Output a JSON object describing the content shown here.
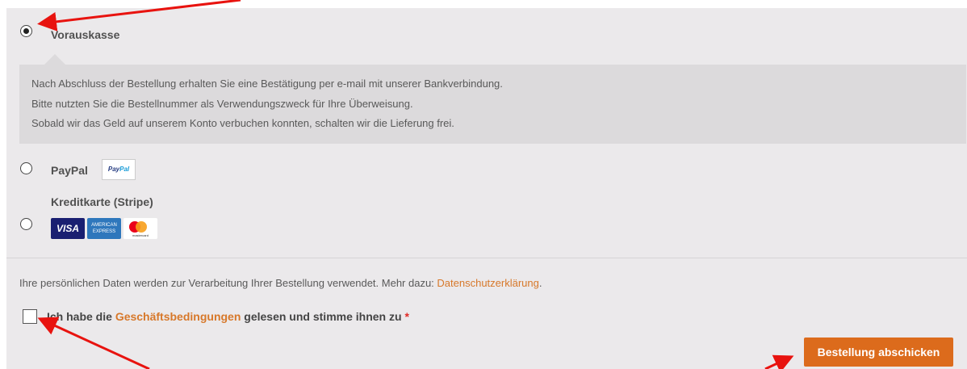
{
  "payment_methods": [
    {
      "label": "Vorauskasse",
      "selected": true
    },
    {
      "label": "PayPal",
      "selected": false,
      "badge": [
        "Pay",
        "Pal"
      ]
    },
    {
      "label": "Kreditkarte (Stripe)",
      "selected": false
    }
  ],
  "prepayment_description": [
    "Nach Abschluss der Bestellung erhalten Sie eine Bestätigung per e-mail mit unserer Bankverbindung.",
    "Bitte nutzten Sie die Bestellnummer als Verwendungszweck für Ihre Überweisung.",
    "Sobald wir das Geld auf unserem Konto verbuchen konnten, schalten wir die Lieferung frei."
  ],
  "cards": {
    "visa": "VISA",
    "amex": [
      "AMERICAN",
      "EXPRESS"
    ],
    "mastercard": "mastercard"
  },
  "privacy": {
    "text": "Ihre persönlichen Daten werden zur Verarbeitung Ihrer Bestellung verwendet. Mehr dazu: ",
    "link": "Datenschutzerklärung",
    "end": "."
  },
  "terms": {
    "checked": false,
    "prefix": "Ich habe die ",
    "link": "Geschäftsbedingungen",
    "suffix": " gelesen und stimme ihnen zu ",
    "required_mark": "*"
  },
  "submit_label": "Bestellung abschicken",
  "colors": {
    "accent": "#dc6b1c",
    "link": "#d7782a",
    "annotation": "#e8130f"
  }
}
